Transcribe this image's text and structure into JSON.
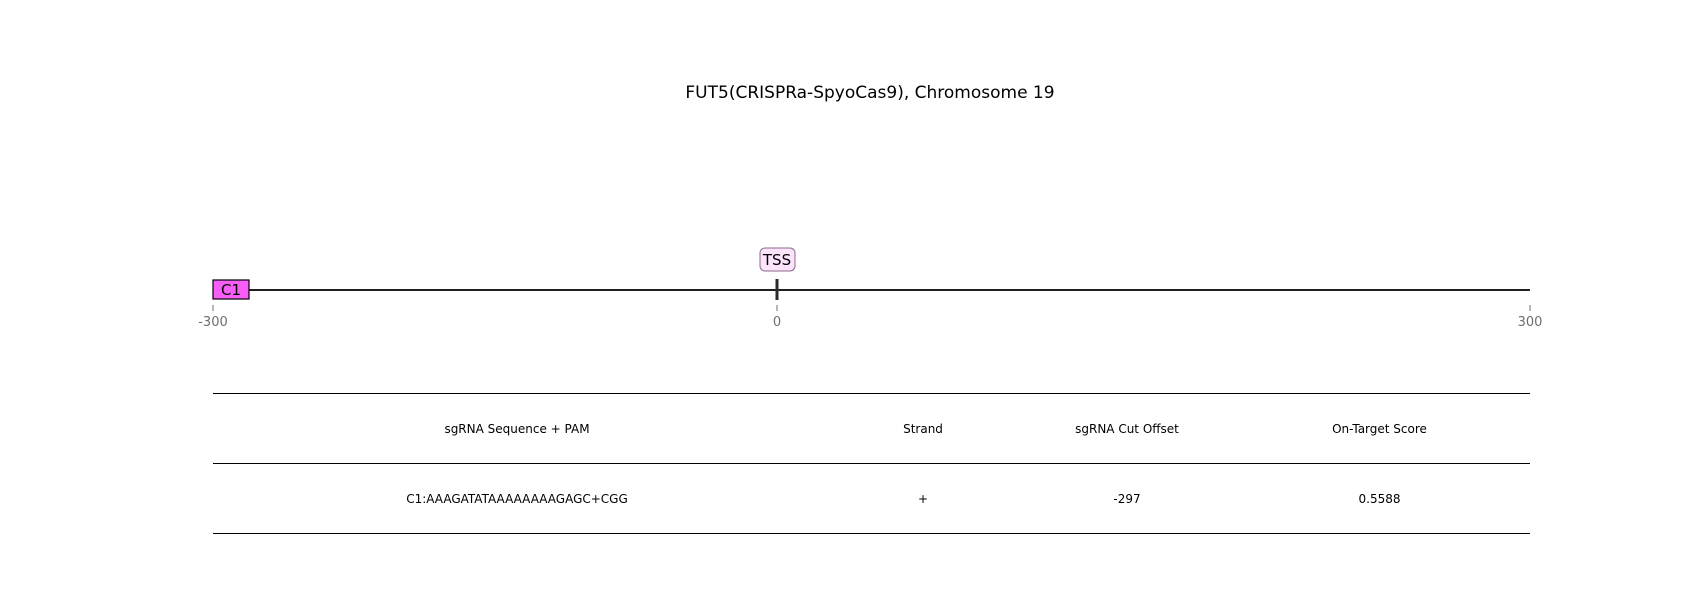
{
  "title": "FUT5(CRISPRa-SpyoCas9), Chromosome 19",
  "track": {
    "range": [
      -300,
      300
    ],
    "ticks": [
      "-300",
      "0",
      "300"
    ],
    "tss_label": "TSS",
    "tss_position": 0,
    "guides": [
      {
        "label": "C1",
        "start": -300,
        "end": -283,
        "color": "#f75ef7"
      }
    ]
  },
  "table": {
    "headers": [
      "sgRNA Sequence + PAM",
      "Strand",
      "sgRNA Cut Offset",
      "On-Target Score"
    ],
    "rows": [
      [
        "C1:AAAGATATAAAAAAAAGAGC+CGG",
        "+",
        "-297",
        "0.5588"
      ]
    ]
  }
}
